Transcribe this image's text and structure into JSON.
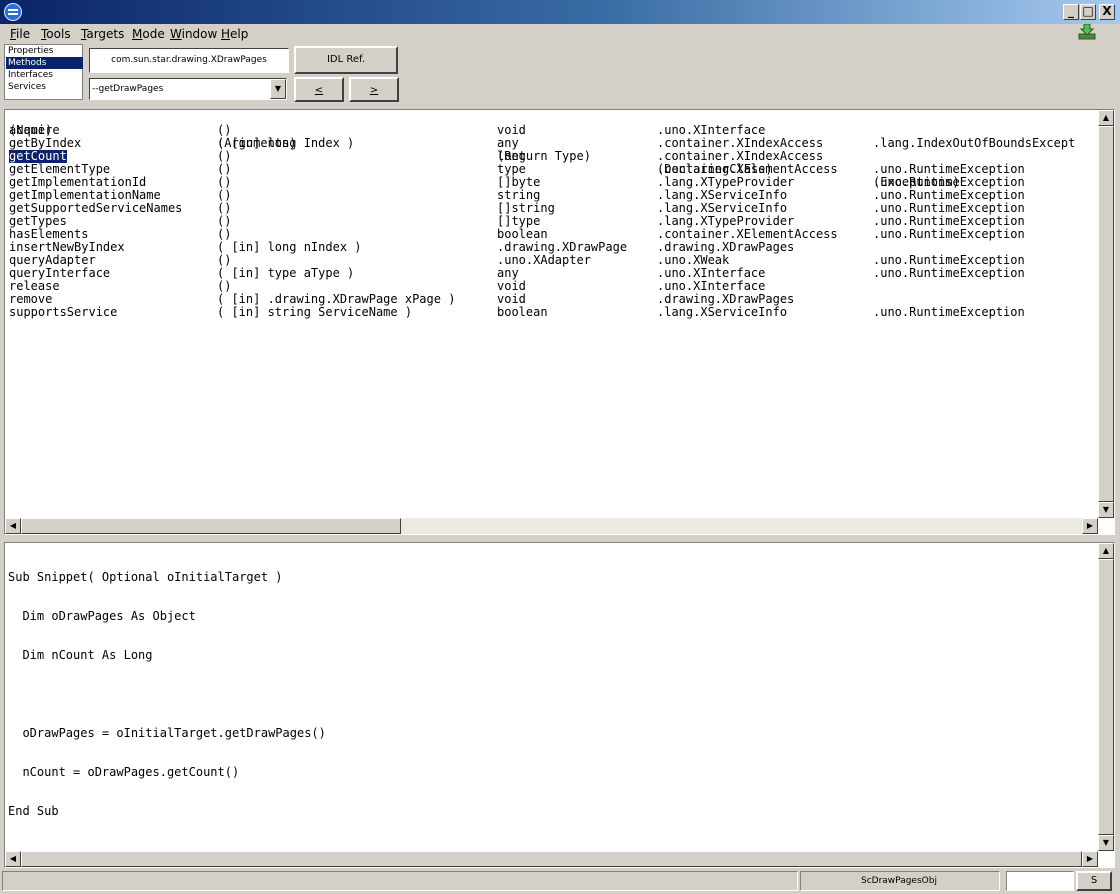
{
  "window": {
    "minimize": "_",
    "maximize": "□",
    "close": "X"
  },
  "menu": [
    "File",
    "Tools",
    "Targets",
    "Mode",
    "Window",
    "Help"
  ],
  "mode_list": [
    {
      "label": "Properties",
      "selected": false
    },
    {
      "label": "Methods",
      "selected": true
    },
    {
      "label": "Interfaces",
      "selected": false
    },
    {
      "label": "Services",
      "selected": false
    }
  ],
  "type_field": "com.sun.star.drawing.XDrawPages",
  "idl_button": "IDL Ref.",
  "method_combo": {
    "value": "--getDrawPages",
    "arrow": "▼"
  },
  "nav": {
    "back": "<",
    "forward": ">"
  },
  "table": {
    "headers": [
      "(Name)",
      "(Arguments)",
      "(Return Type)",
      "(DeclaringClass)",
      "(Exceptions)"
    ],
    "selected_row": 2,
    "rows": [
      [
        "acquire",
        "()",
        "void",
        ".uno.XInterface",
        ""
      ],
      [
        "getByIndex",
        "( [in] long Index )",
        "any",
        ".container.XIndexAccess",
        ".lang.IndexOutOfBoundsExcept"
      ],
      [
        "getCount",
        "()",
        "long",
        ".container.XIndexAccess",
        ""
      ],
      [
        "getElementType",
        "()",
        "type",
        ".container.XElementAccess",
        ".uno.RuntimeException"
      ],
      [
        "getImplementationId",
        "()",
        "[]byte",
        ".lang.XTypeProvider",
        ".uno.RuntimeException"
      ],
      [
        "getImplementationName",
        "()",
        "string",
        ".lang.XServiceInfo",
        ".uno.RuntimeException"
      ],
      [
        "getSupportedServiceNames",
        "()",
        "[]string",
        ".lang.XServiceInfo",
        ".uno.RuntimeException"
      ],
      [
        "getTypes",
        "()",
        "[]type",
        ".lang.XTypeProvider",
        ".uno.RuntimeException"
      ],
      [
        "hasElements",
        "()",
        "boolean",
        ".container.XElementAccess",
        ".uno.RuntimeException"
      ],
      [
        "insertNewByIndex",
        "( [in] long nIndex )",
        ".drawing.XDrawPage",
        ".drawing.XDrawPages",
        ""
      ],
      [
        "queryAdapter",
        "()",
        ".uno.XAdapter",
        ".uno.XWeak",
        ".uno.RuntimeException"
      ],
      [
        "queryInterface",
        "( [in] type aType )",
        "any",
        ".uno.XInterface",
        ".uno.RuntimeException"
      ],
      [
        "release",
        "()",
        "void",
        ".uno.XInterface",
        ""
      ],
      [
        "remove",
        "( [in] .drawing.XDrawPage xPage )",
        "void",
        ".drawing.XDrawPages",
        ""
      ],
      [
        "supportsService",
        "( [in] string ServiceName )",
        "boolean",
        ".lang.XServiceInfo",
        ".uno.RuntimeException"
      ]
    ]
  },
  "code_lines": [
    "Sub Snippet( Optional oInitialTarget )",
    "  Dim oDrawPages As Object",
    "  Dim nCount As Long",
    "",
    "  oDrawPages = oInitialTarget.getDrawPages()",
    "  nCount = oDrawPages.getCount()",
    "End Sub"
  ],
  "status": {
    "object_name": "ScDrawPagesObj",
    "field": "",
    "button": "S"
  },
  "scroll_arrows": {
    "up": "▲",
    "down": "▼",
    "left": "◀",
    "right": "▶"
  }
}
